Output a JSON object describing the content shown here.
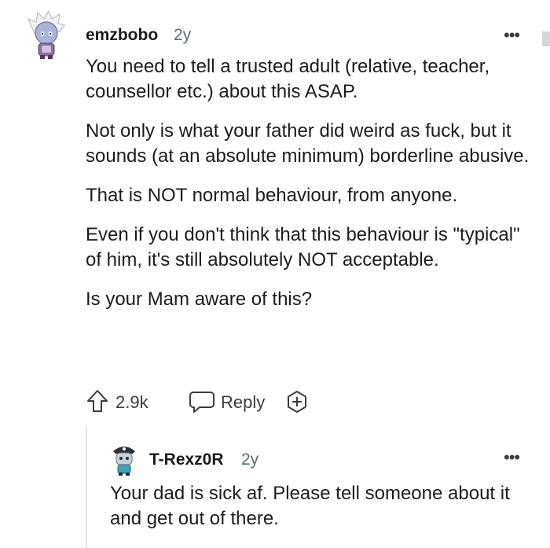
{
  "comment": {
    "avatar": "robot-snowman-avatar-icon",
    "username": "emzbobo",
    "age": "2y",
    "more_icon": "more-options-icon",
    "paragraphs": [
      "You need to tell a trusted adult (relative, teacher, counsellor etc.) about this ASAP.",
      "Not only is what your father did weird as fuck, but it sounds (at an absolute minimum) borderline abusive.",
      "That is NOT normal behaviour, from anyone.",
      "Even if you don't think that this behaviour is \"typical\" of him, it's still absolutely NOT acceptable.",
      "Is your Mam aware of this?"
    ],
    "actions": {
      "upvote_icon": "upvote-arrow-icon",
      "vote_count": "2.9k",
      "reply_icon": "speech-bubble-icon",
      "reply_label": "Reply",
      "award_icon": "award-plus-icon"
    }
  },
  "reply": {
    "avatar": "pirate-robot-avatar-icon",
    "username": "T-Rexz0R",
    "age": "2y",
    "more_icon": "more-options-icon",
    "paragraphs": [
      "Your dad is sick af. Please tell someone about it and get out of there."
    ]
  },
  "colors": {
    "text": "#1c1c1c",
    "meta": "#576f76",
    "icon": "#3c3c3c",
    "thread_line": "#e6e6e6"
  }
}
